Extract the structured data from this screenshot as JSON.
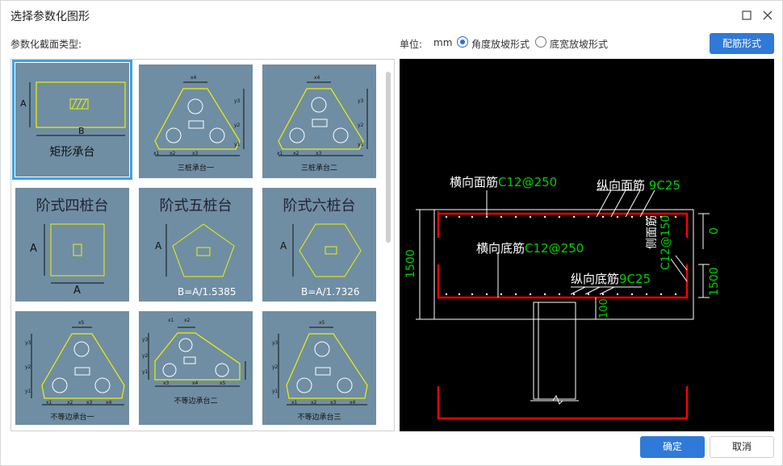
{
  "window": {
    "title": "选择参数化图形",
    "maximize_icon": "maximize-icon",
    "close_icon": "close-icon"
  },
  "section_label": "参数化截面类型:",
  "unit": {
    "label": "单位:",
    "value": "mm"
  },
  "slope_options": [
    {
      "label": "角度放坡形式",
      "selected": true
    },
    {
      "label": "底宽放坡形式",
      "selected": false
    }
  ],
  "buttons": {
    "rebar_form": "配筋形式",
    "ok": "确定",
    "cancel": "取消"
  },
  "colors": {
    "accent": "#2f7ad8",
    "thumb_bg": "#6f8ea3",
    "shape_line": "#f0f000",
    "rebar_red": "#ff0000",
    "label_green": "#00d000"
  },
  "thumbs": [
    {
      "title": "矩形承台",
      "dim_a": "A",
      "dim_b": "B",
      "selected": true
    },
    {
      "title": "三桩承台一",
      "dims": [
        "x4",
        "y3",
        "y2",
        "y1",
        "x1",
        "x2",
        "x3"
      ]
    },
    {
      "title": "三桩承台二",
      "dims": [
        "x4",
        "y3",
        "y2",
        "y1",
        "x1",
        "x2",
        "x3"
      ]
    },
    {
      "title": "阶式四桩台",
      "dim_a": "A",
      "dim_b": "A"
    },
    {
      "title": "阶式五桩台",
      "dim_a": "A",
      "formula": "B=A/1.5385"
    },
    {
      "title": "阶式六桩台",
      "dim_a": "A",
      "formula": "B=A/1.7326"
    },
    {
      "title": "不等边承台一",
      "dims": [
        "x5",
        "y3",
        "y2",
        "y1",
        "x1",
        "x2",
        "x3",
        "x4"
      ]
    },
    {
      "title": "不等边承台二",
      "dims": [
        "x1",
        "x2",
        "y3",
        "y2",
        "y1",
        "x3",
        "x4",
        "x5"
      ]
    },
    {
      "title": "不等边承台三",
      "dims": [
        "x5",
        "y3",
        "y2",
        "y1",
        "x1",
        "x2",
        "x3",
        "x4"
      ]
    }
  ],
  "preview": {
    "top_transverse": {
      "name": "横向面筋",
      "spec": "C12@250"
    },
    "top_longitudinal": {
      "name": "纵向面筋",
      "spec": "9C25"
    },
    "bottom_transverse": {
      "name": "横向底筋",
      "spec": "C12@250"
    },
    "bottom_longitudinal": {
      "name": "纵向底筋",
      "spec": "9C25"
    },
    "side": {
      "name": "侧面筋",
      "spec": "C12@150"
    },
    "dim_height": "1500",
    "dim_right_top": "0",
    "dim_right_bottom": "1500",
    "dim_cover": "100"
  }
}
